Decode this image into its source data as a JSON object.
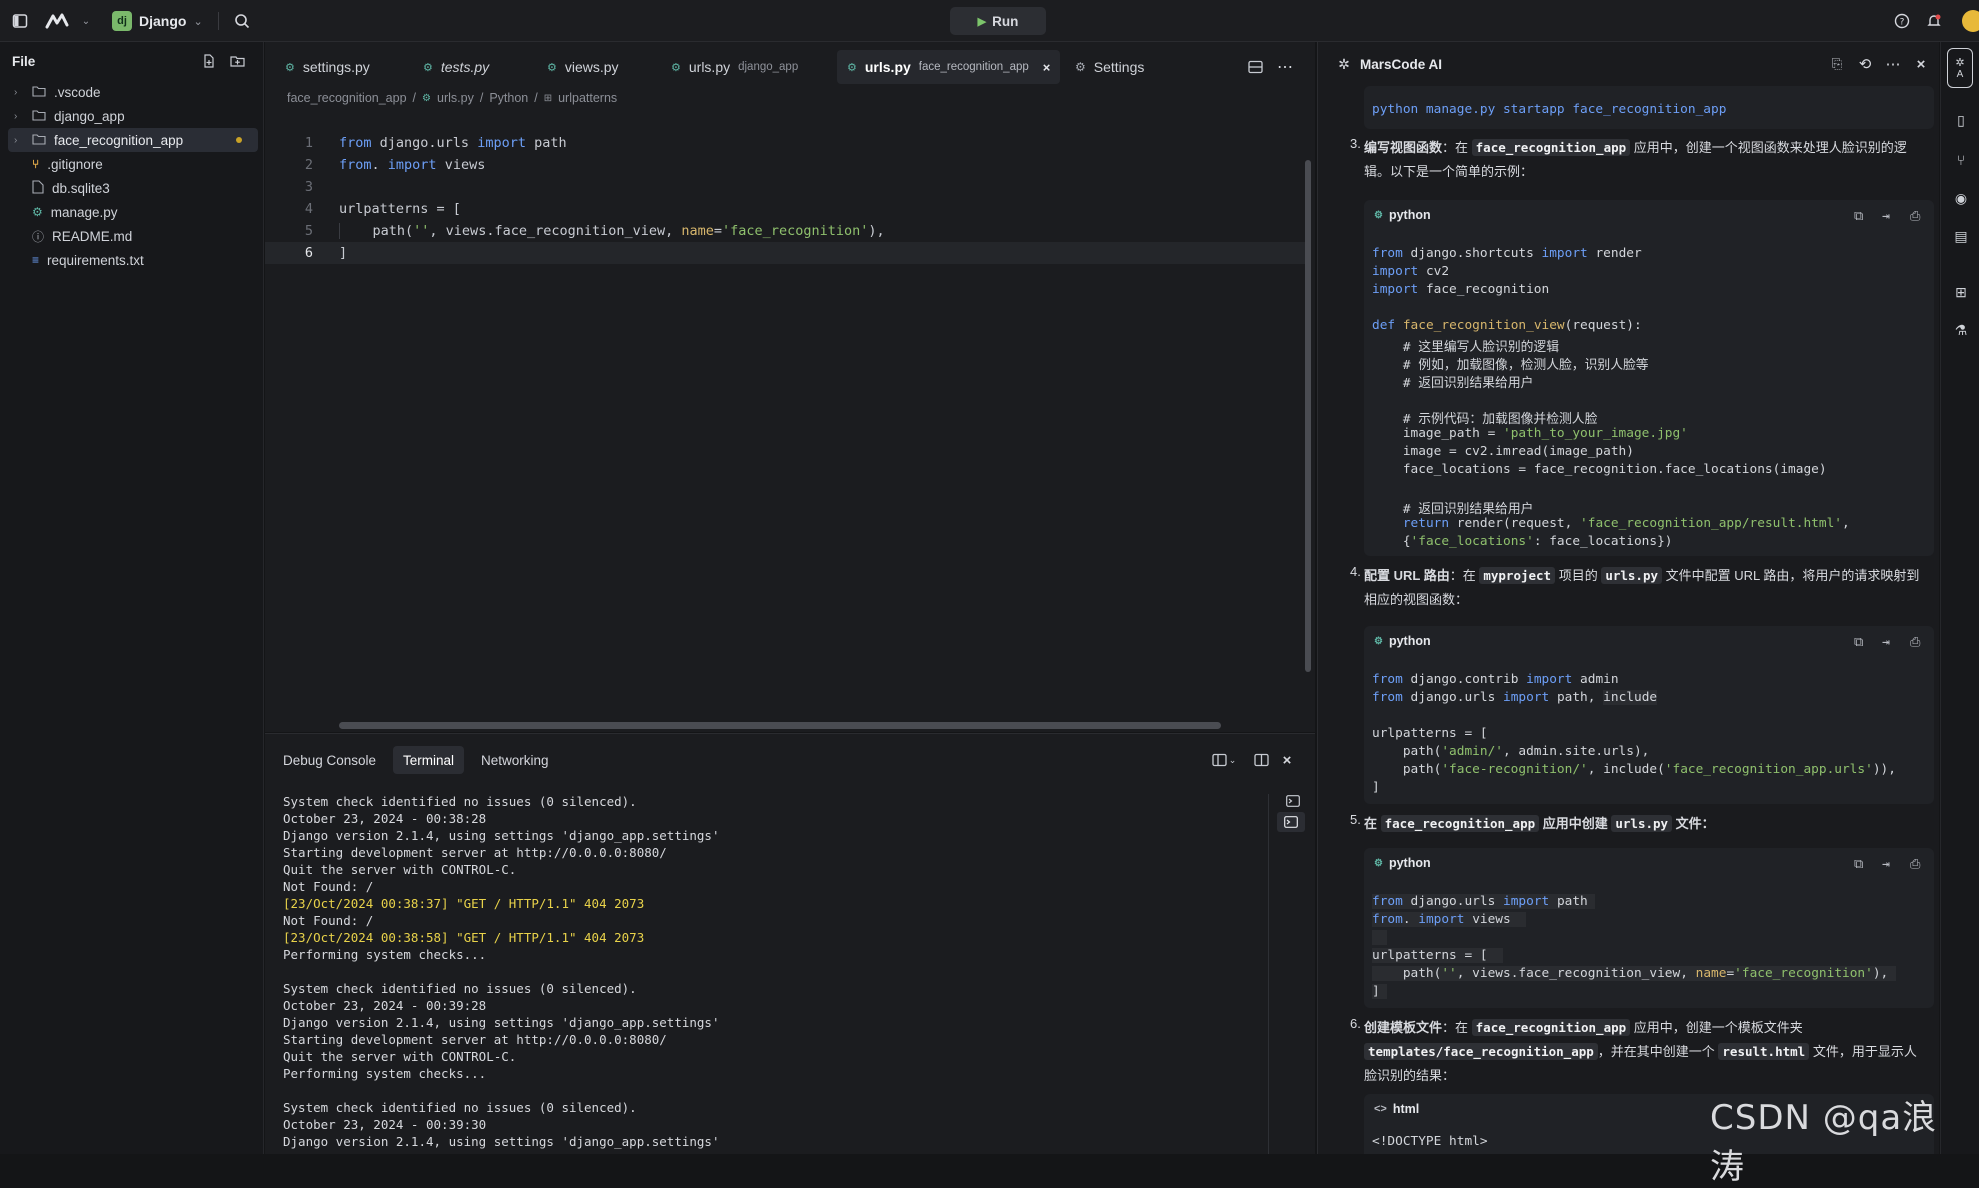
{
  "titlebar": {
    "project": "Django",
    "project_badge": "dj",
    "run_label": "Run"
  },
  "sidebar": {
    "title": "File",
    "items": [
      {
        "label": ".vscode",
        "kind": "folder"
      },
      {
        "label": "django_app",
        "kind": "folder"
      },
      {
        "label": "face_recognition_app",
        "kind": "folder",
        "selected": true
      },
      {
        "label": ".gitignore",
        "kind": "git"
      },
      {
        "label": "db.sqlite3",
        "kind": "file"
      },
      {
        "label": "manage.py",
        "kind": "python"
      },
      {
        "label": "README.md",
        "kind": "info"
      },
      {
        "label": "requirements.txt",
        "kind": "list"
      }
    ]
  },
  "editor": {
    "tabs": [
      {
        "label": "settings.py",
        "hint": ""
      },
      {
        "label": "tests.py",
        "hint": ""
      },
      {
        "label": "views.py",
        "hint": ""
      },
      {
        "label": "urls.py",
        "hint": "django_app"
      },
      {
        "label": "urls.py",
        "hint": "face_recognition_app",
        "active": true
      },
      {
        "label": "Settings",
        "hint": ""
      }
    ],
    "breadcrumb": [
      "face_recognition_app",
      "urls.py",
      "Python",
      "urlpatterns"
    ],
    "line_numbers": [
      "1",
      "2",
      "3",
      "4",
      "5",
      "6"
    ]
  },
  "panel": {
    "tabs": [
      "Debug Console",
      "Terminal",
      "Networking"
    ],
    "active_tab": "Terminal",
    "terminal_lines": [
      "System check identified no issues (0 silenced).",
      "October 23, 2024 - 00:38:28",
      "Django version 2.1.4, using settings 'django_app.settings'",
      "Starting development server at http://0.0.0.0:8080/",
      "Quit the server with CONTROL-C.",
      "Not Found: /",
      "[23/Oct/2024 00:38:37] \"GET / HTTP/1.1\" 404 2073",
      "Not Found: /",
      "[23/Oct/2024 00:38:58] \"GET / HTTP/1.1\" 404 2073",
      "Performing system checks...",
      "",
      "System check identified no issues (0 silenced).",
      "October 23, 2024 - 00:39:28",
      "Django version 2.1.4, using settings 'django_app.settings'",
      "Starting development server at http://0.0.0.0:8080/",
      "Quit the server with CONTROL-C.",
      "Performing system checks...",
      "",
      "System check identified no issues (0 silenced).",
      "October 23, 2024 - 00:39:30",
      "Django version 2.1.4, using settings 'django_app.settings'"
    ]
  },
  "ai": {
    "title": "MarsCode AI",
    "top_command": "python manage.py startapp face_recognition_app",
    "step3": {
      "num": "3.",
      "bold": "编写视图函数",
      "t1": "：在 ",
      "code": "face_recognition_app",
      "t2": " 应用中，创建一个视图函数来处理人脸识别的逻",
      "t3": "辑。以下是一个简单的示例："
    },
    "step4": {
      "num": "4.",
      "bold": "配置 URL 路由",
      "t1": "：在 ",
      "code1": "myproject",
      "t2": " 项目的 ",
      "code2": "urls.py",
      "t3": " 文件中配置 URL 路由，将用户的请求映射到",
      "t4": "相应的视图函数："
    },
    "step5": {
      "num": "5.",
      "bold1": "在 ",
      "code1": "face_recognition_app",
      "bold2": " 应用中创建 ",
      "code2": "urls.py",
      "bold3": " 文件："
    },
    "step6": {
      "num": "6.",
      "bold": "创建模板文件",
      "t1": "：在 ",
      "code1": "face_recognition_app",
      "t2": " 应用中，创建一个模板文件夹",
      "code2": "templates/face_recognition_app",
      "t3": "，并在其中创建一个 ",
      "code3": "result.html",
      "t4": " 文件，用于显示人",
      "t5": "脸识别的结果："
    },
    "lang_python": "python",
    "lang_html": "html",
    "html_first_line": "<!DOCTYPE html>",
    "comments": {
      "c1": "# 这里编写人脸识别的逻辑",
      "c2": "# 例如，加载图像，检测人脸，识别人脸等",
      "c3": "# 返回识别结果给用户",
      "c4": "# 示例代码：加载图像并检测人脸",
      "c5": "# 返回识别结果给用户"
    }
  },
  "watermark": "CSDN @qa浪涛"
}
